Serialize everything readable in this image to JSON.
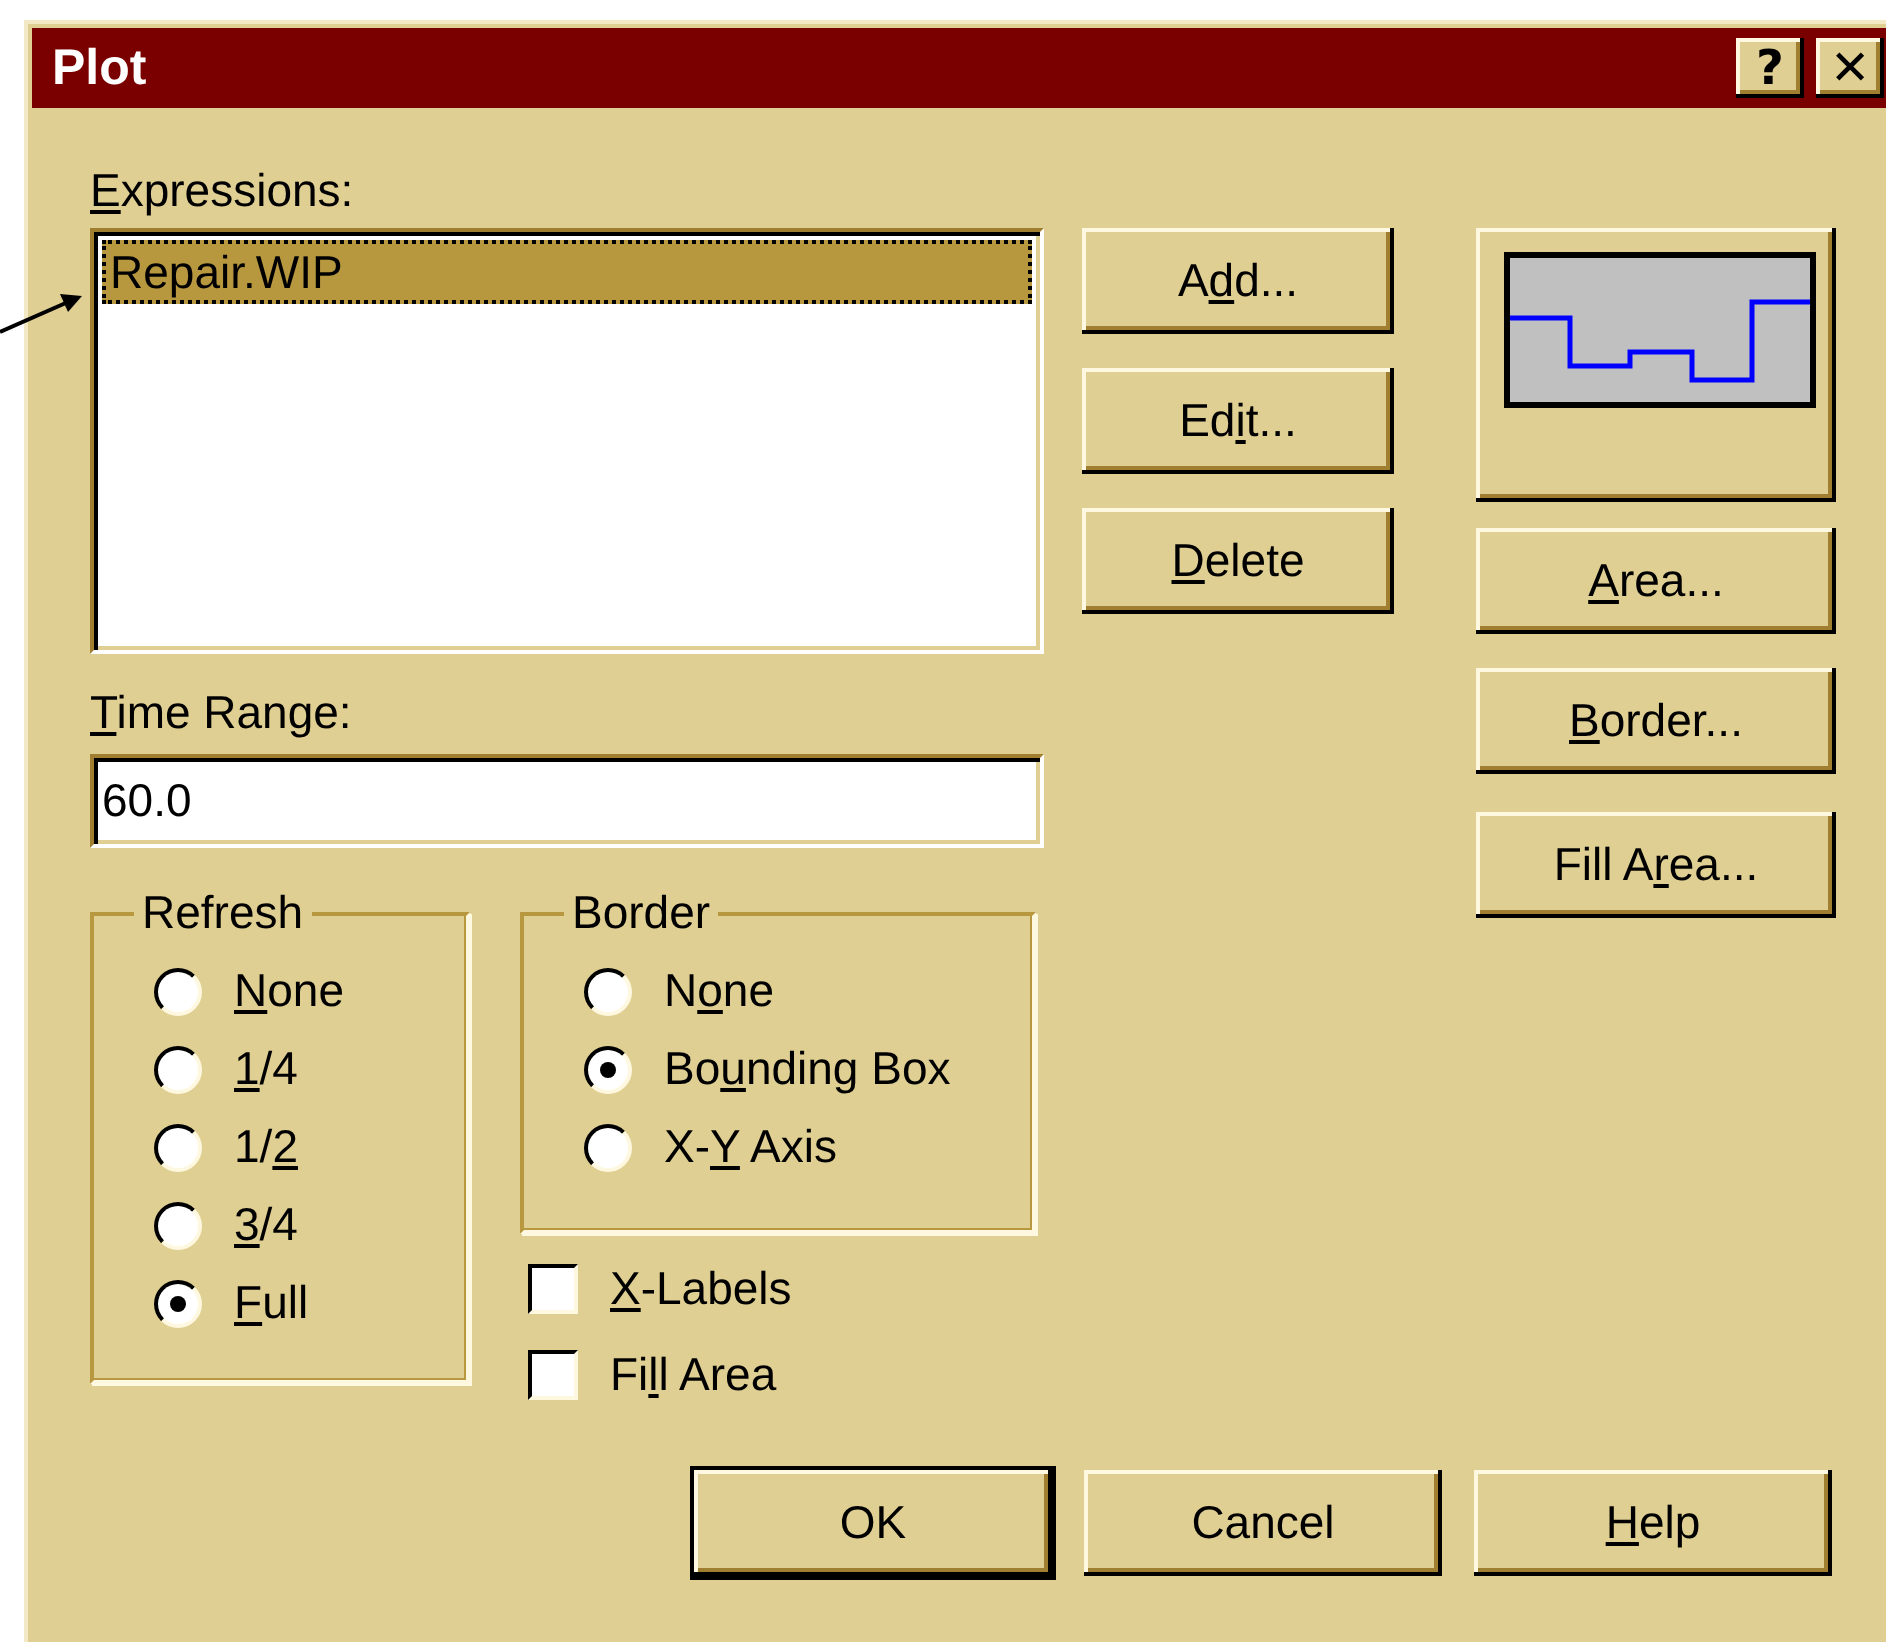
{
  "window": {
    "title": "Plot",
    "title_buttons": [
      {
        "label": "?"
      },
      {
        "label": "✕"
      }
    ]
  },
  "expressions": {
    "label": {
      "key": "E",
      "post": "xpressions:"
    },
    "items": [
      {
        "text": "Repair.WIP",
        "selected": true
      }
    ]
  },
  "expression_buttons": [
    {
      "label": {
        "pre": "A",
        "key": "d",
        "post": "d..."
      }
    },
    {
      "label": {
        "pre": "Ed",
        "key": "i",
        "post": "t..."
      }
    },
    {
      "label": {
        "key": "D",
        "post": "elete"
      }
    }
  ],
  "style_buttons": [
    {
      "label": {
        "key": "A",
        "post": "rea..."
      }
    },
    {
      "label": {
        "key": "B",
        "post": "order..."
      }
    },
    {
      "label": {
        "pre": "Fill A",
        "key": "r",
        "post": "ea..."
      }
    }
  ],
  "time_range": {
    "label": {
      "key": "T",
      "post": "ime Range:"
    },
    "value": "60.0"
  },
  "refresh": {
    "legend": "Refresh",
    "options": [
      {
        "label": {
          "key": "N",
          "post": "one"
        },
        "selected": false
      },
      {
        "label": {
          "key": "1",
          "post": "/4"
        },
        "selected": false
      },
      {
        "label": {
          "pre": "1/",
          "key": "2"
        },
        "selected": false
      },
      {
        "label": {
          "key": "3",
          "post": "/4"
        },
        "selected": false
      },
      {
        "label": {
          "key": "F",
          "post": "ull"
        },
        "selected": true
      }
    ]
  },
  "border": {
    "legend": "Border",
    "options": [
      {
        "label": {
          "pre": "N",
          "key": "o",
          "post": "ne"
        },
        "selected": false
      },
      {
        "label": {
          "pre": "Bo",
          "key": "u",
          "post": "nding Box"
        },
        "selected": true
      },
      {
        "label": {
          "pre": "X-",
          "key": "Y",
          "post": " Axis"
        },
        "selected": false
      }
    ]
  },
  "checkboxes": [
    {
      "label": {
        "key": "X",
        "post": "-Labels"
      },
      "checked": false
    },
    {
      "label": {
        "pre": "Fi",
        "key": "l",
        "post": "l Area"
      },
      "checked": false
    }
  ],
  "dialog_buttons": [
    {
      "label": "OK",
      "default": true
    },
    {
      "label": "Cancel",
      "default": false
    },
    {
      "label": {
        "key": "H",
        "post": "elp"
      },
      "default": false
    }
  ]
}
